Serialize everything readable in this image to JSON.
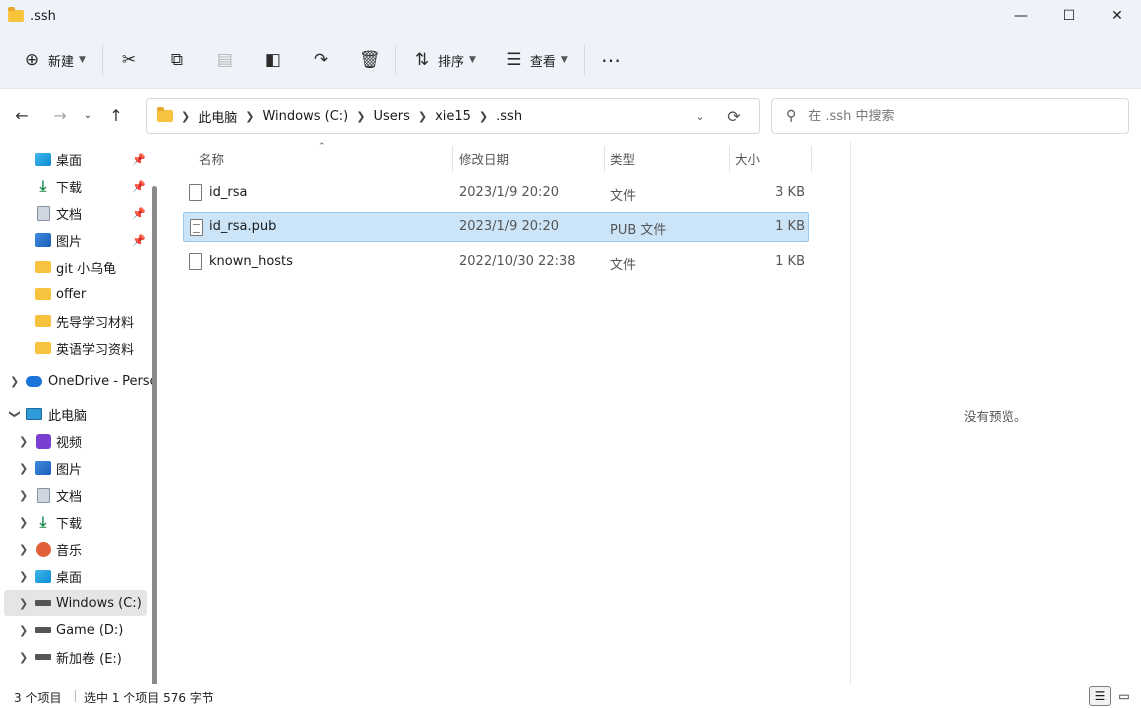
{
  "window": {
    "title": ".ssh"
  },
  "toolbar": {
    "new_label": "新建",
    "sort_label": "排序",
    "view_label": "查看"
  },
  "address": {
    "crumbs": [
      "此电脑",
      "Windows (C:)",
      "Users",
      "xie15",
      ".ssh"
    ]
  },
  "search": {
    "placeholder": "在 .ssh 中搜索"
  },
  "sidebar": {
    "items": [
      {
        "label": "桌面",
        "icon": "desktop-icon",
        "pinned": true
      },
      {
        "label": "下载",
        "icon": "download-icon",
        "pinned": true
      },
      {
        "label": "文档",
        "icon": "document-icon",
        "pinned": true
      },
      {
        "label": "图片",
        "icon": "pictures-icon",
        "pinned": true
      },
      {
        "label": "git 小乌龟",
        "icon": "folder-icon"
      },
      {
        "label": "offer",
        "icon": "folder-icon"
      },
      {
        "label": "先导学习材料",
        "icon": "folder-icon"
      },
      {
        "label": "英语学习资料",
        "icon": "folder-icon"
      },
      {
        "label": "OneDrive - Perso",
        "icon": "onedrive-icon"
      },
      {
        "label": "此电脑",
        "icon": "this-pc-icon"
      },
      {
        "label": "视频",
        "icon": "videos-icon"
      },
      {
        "label": "图片",
        "icon": "pictures-icon"
      },
      {
        "label": "文档",
        "icon": "document-icon"
      },
      {
        "label": "下载",
        "icon": "download-icon"
      },
      {
        "label": "音乐",
        "icon": "music-icon"
      },
      {
        "label": "桌面",
        "icon": "desktop-icon"
      },
      {
        "label": "Windows (C:)",
        "icon": "drive-icon",
        "selected": true
      },
      {
        "label": "Game (D:)",
        "icon": "drive-icon"
      },
      {
        "label": "新加卷 (E:)",
        "icon": "drive-icon"
      }
    ]
  },
  "columns": {
    "name": "名称",
    "modified": "修改日期",
    "type": "类型",
    "size": "大小"
  },
  "files": [
    {
      "name": "id_rsa",
      "modified": "2023/1/9 20:20",
      "type": "文件",
      "size": "3 KB"
    },
    {
      "name": "id_rsa.pub",
      "modified": "2023/1/9 20:20",
      "type": "PUB 文件",
      "size": "1 KB",
      "selected": true
    },
    {
      "name": "known_hosts",
      "modified": "2022/10/30 22:38",
      "type": "文件",
      "size": "1 KB"
    }
  ],
  "preview": {
    "text": "没有预览。"
  },
  "status": {
    "item_count": "3 个项目",
    "selection": "选中 1 个项目  576 字节"
  }
}
